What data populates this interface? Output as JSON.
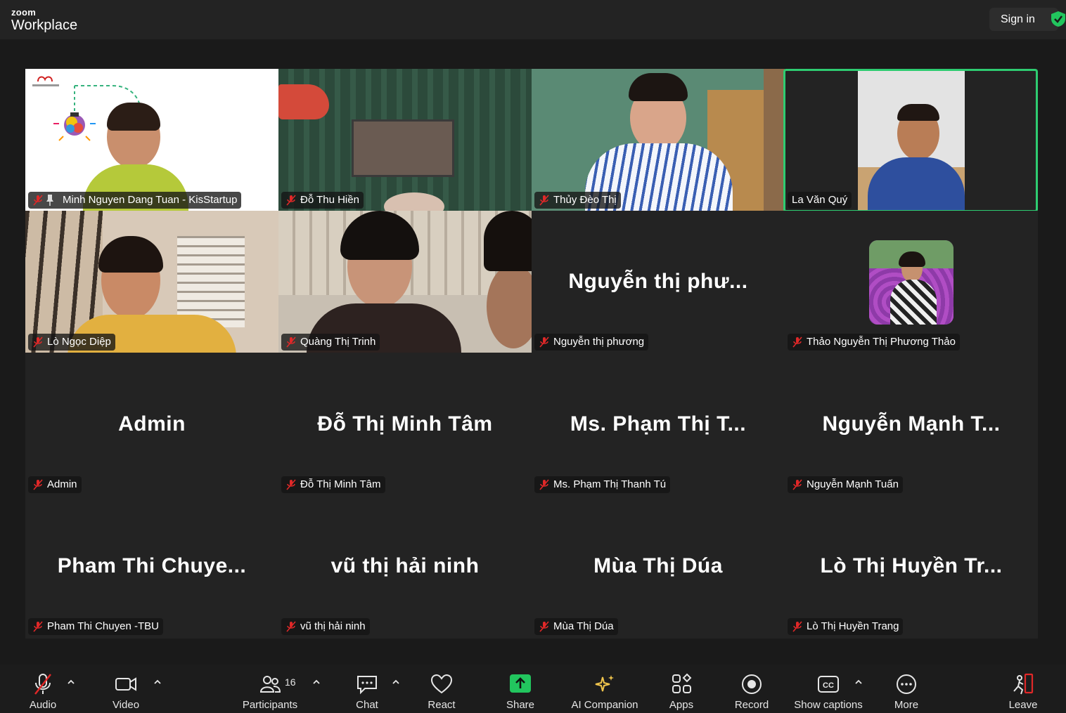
{
  "app": {
    "logo_small": "zoom",
    "logo_big": "Workplace",
    "sign_in": "Sign in"
  },
  "tiles": [
    {
      "name": "Minh Nguyen Dang Tuan - KisStartup",
      "big": "",
      "video": true,
      "pinned": true,
      "muted": true
    },
    {
      "name": "Đỗ Thu Hiền",
      "big": "",
      "video": true,
      "pinned": false,
      "muted": true
    },
    {
      "name": "Thủy Đèo Thị",
      "big": "",
      "video": true,
      "pinned": false,
      "muted": true
    },
    {
      "name": "La Văn Quý",
      "big": "",
      "video": true,
      "pinned": false,
      "muted": false,
      "active": true
    },
    {
      "name": "Lò Ngọc Diệp",
      "big": "",
      "video": true,
      "pinned": false,
      "muted": true
    },
    {
      "name": "Quàng Thị Trinh",
      "big": "",
      "video": true,
      "pinned": false,
      "muted": true
    },
    {
      "name": "Nguyễn thị phương",
      "big": "Nguyễn thị phư...",
      "video": false,
      "pinned": false,
      "muted": true
    },
    {
      "name": "Thảo Nguyễn Thị Phương Thảo",
      "big": "",
      "video": false,
      "avatar": true,
      "pinned": false,
      "muted": true
    },
    {
      "name": "Admin",
      "big": "Admin",
      "video": false,
      "pinned": false,
      "muted": true
    },
    {
      "name": "Đỗ Thị Minh Tâm",
      "big": "Đỗ Thị Minh Tâm",
      "video": false,
      "pinned": false,
      "muted": true
    },
    {
      "name": "Ms. Phạm Thị Thanh Tú",
      "big": "Ms. Phạm Thị T...",
      "video": false,
      "pinned": false,
      "muted": true
    },
    {
      "name": "Nguyễn Mạnh Tuấn",
      "big": "Nguyễn Mạnh T...",
      "video": false,
      "pinned": false,
      "muted": true
    },
    {
      "name": "Pham Thi Chuyen -TBU",
      "big": "Pham Thi Chuye...",
      "video": false,
      "pinned": false,
      "muted": true
    },
    {
      "name": "vũ thị hải ninh",
      "big": "vũ thị hải ninh",
      "video": false,
      "pinned": false,
      "muted": true
    },
    {
      "name": "Mùa Thị Dúa",
      "big": "Mùa Thị Dúa",
      "video": false,
      "pinned": false,
      "muted": true
    },
    {
      "name": "Lò Thị Huyền Trang",
      "big": "Lò Thị Huyền Tr...",
      "video": false,
      "pinned": false,
      "muted": true
    }
  ],
  "toolbar": {
    "audio": "Audio",
    "video": "Video",
    "participants": "Participants",
    "participants_count": "16",
    "chat": "Chat",
    "react": "React",
    "share": "Share",
    "ai_companion": "AI Companion",
    "apps": "Apps",
    "record": "Record",
    "show_captions": "Show captions",
    "more": "More",
    "leave": "Leave"
  },
  "colors": {
    "active_speaker": "#2ecc71",
    "share_green": "#22c55e",
    "muted_red": "#e02828",
    "leave_red": "#e02828"
  }
}
